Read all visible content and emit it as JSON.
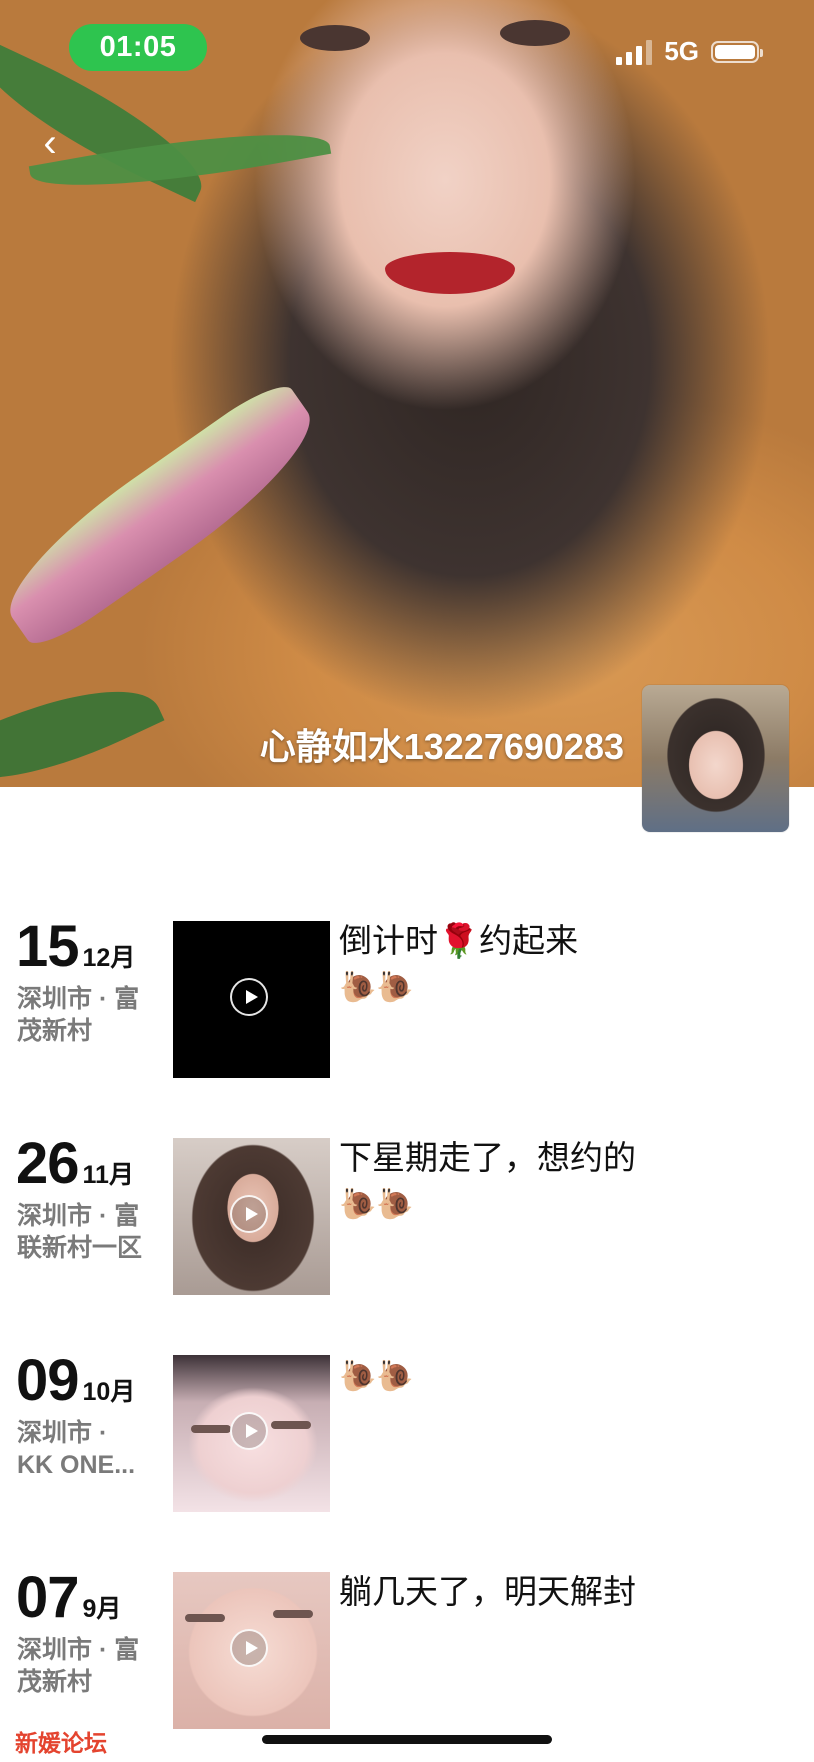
{
  "status_bar": {
    "time": "01:05",
    "network": "5G"
  },
  "cover": {
    "nickname": "心静如水13227690283"
  },
  "posts": [
    {
      "day": "15",
      "month": "12月",
      "location_line1": "深圳市 · 富",
      "location_line2": "茂新村",
      "text": "倒计时🌹约起来",
      "emoji_line": "🐌🐌"
    },
    {
      "day": "26",
      "month": "11月",
      "location_line1": "深圳市 · 富",
      "location_line2": "联新村一区",
      "text": "下星期走了，想约的",
      "emoji_line": "🐌🐌"
    },
    {
      "day": "09",
      "month": "10月",
      "location_line1": "深圳市 ·",
      "location_line2": "KK ONE...",
      "text": "",
      "emoji_line": "🐌🐌"
    },
    {
      "day": "07",
      "month": "9月",
      "location_line1": "深圳市 · 富",
      "location_line2": "茂新村",
      "text": "躺几天了，明天解封",
      "emoji_line": ""
    }
  ],
  "footer": {
    "forum_label": "新媛论坛"
  },
  "colors": {
    "time_pill": "#2ec44f",
    "forum_red": "#e4442f",
    "location_gray": "#7a7a7a"
  }
}
